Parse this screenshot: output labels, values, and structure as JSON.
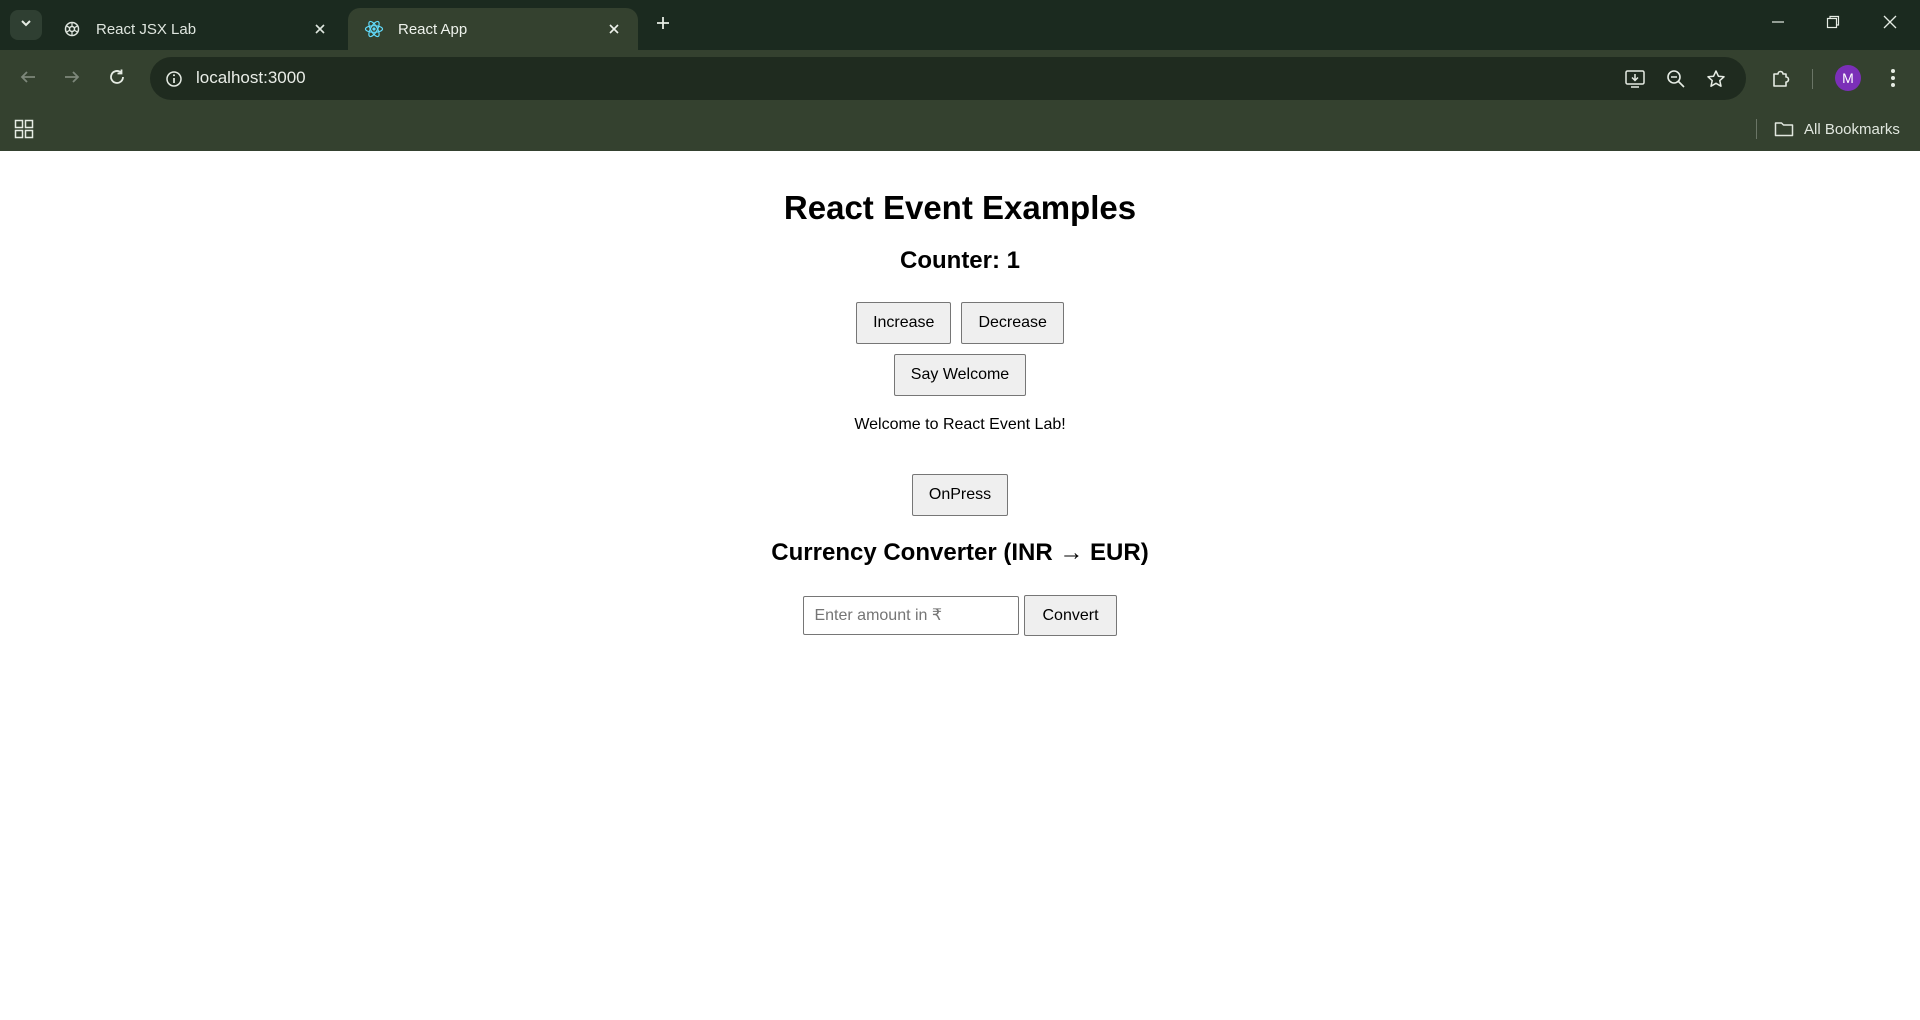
{
  "browser": {
    "tabs": [
      {
        "title": "React JSX Lab",
        "active": false,
        "favicon": "openai-icon"
      },
      {
        "title": "React App",
        "active": true,
        "favicon": "react-icon"
      }
    ],
    "url": "localhost:3000",
    "profile_initial": "M",
    "bookmarks_label": "All Bookmarks",
    "colors": {
      "tabstrip": "#1b2a1f",
      "toolbar": "#34412f",
      "avatar": "#7b2fb8"
    }
  },
  "page": {
    "title": "React Event Examples",
    "counter_label": "Counter: 1",
    "increase_label": "Increase",
    "decrease_label": "Decrease",
    "say_welcome_label": "Say Welcome",
    "welcome_message": "Welcome to React Event Lab!",
    "onpress_label": "OnPress",
    "currency_title": "Currency Converter (INR → EUR)",
    "amount_placeholder": "Enter amount in ₹",
    "amount_value": "",
    "convert_label": "Convert"
  }
}
